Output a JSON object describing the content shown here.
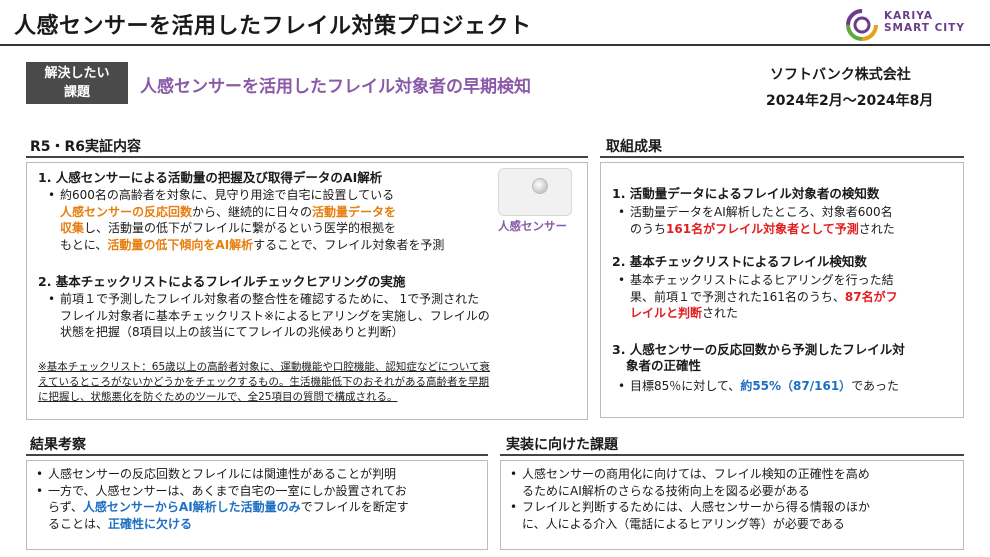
{
  "header": {
    "title": "人感センサーを活用したフレイル対策プロジェクト",
    "logo_line1": "KARIYA",
    "logo_line2": "SMART CITY"
  },
  "issue": {
    "badge_line1": "解決したい",
    "badge_line2": "課題",
    "text": "人感センサーを活用したフレイル対象者の早期検知",
    "company": "ソフトバンク株式会社",
    "period": "2024年2月～2024年8月"
  },
  "r5r6": {
    "heading": "R5・R6実証内容",
    "item1_title": "1. 人感センサーによる活動量の把握及び取得データのAI解析",
    "item1_l1": "約600名の高齢者を対象に、見守り用途で自宅に設置している",
    "item1_l2a": "人感センサーの反応回数",
    "item1_l2b": "から、継続的に日々の",
    "item1_l2c": "活動量データを",
    "item1_l3a": "収集",
    "item1_l3b": "し、活動量の低下がフレイルに繋がるという医学的根拠を",
    "item1_l4a": "もとに、",
    "item1_l4b": "活動量の低下傾向をAI解析",
    "item1_l4c": "することで、フレイル対象者を予測",
    "sensor_caption": "人感センサー",
    "item2_title": "2. 基本チェックリストによるフレイルチェックヒアリングの実施",
    "item2_l1": "前項１で予測したフレイル対象者の整合性を確認するために、 1で予測された",
    "item2_l2": "フレイル対象者に基本チェックリスト※によるヒアリングを実施し、フレイルの",
    "item2_l3": "状態を把握（8項目以上の該当にてフレイルの兆候ありと判断）",
    "note_l1": "※基本チェックリスト：65歳以上の高齢者対象に、運動機能や口腔機能、認知症などについて衰",
    "note_l2": "えているところがないかどうかをチェックするもの。生活機能低下のおそれがある高齢者を早期",
    "note_l3": "に把握し、状態悪化を防ぐためのツールで、全25項目の質問で構成される。"
  },
  "results": {
    "heading": "取組成果",
    "r1_title": "1. 活動量データによるフレイル対象者の検知数",
    "r1_l1": "活動量データをAI解析したところ、対象者600名",
    "r1_l2a": "のうち",
    "r1_l2b": "161名がフレイル対象者として予測",
    "r1_l2c": "された",
    "r2_title": "2. 基本チェックリストによるフレイル検知数",
    "r2_l1": "基本チェックリストによるヒアリングを行った結",
    "r2_l2a": "果、前項１で予測された161名のうち、",
    "r2_l2b": "87名がフ",
    "r2_l3a": "レイルと判断",
    "r2_l3b": "された",
    "r3_title_l1": "3. 人感センサーの反応回数から予測したフレイル対",
    "r3_title_l2": "象者の正確性",
    "r3_l1a": "目標85％に対して、",
    "r3_l1b": "約55%（87/161）",
    "r3_l1c": "であった"
  },
  "consideration": {
    "heading": "結果考察",
    "b1": "人感センサーの反応回数とフレイルには関連性があることが判明",
    "b2_l1": "一方で、人感センサーは、あくまで自宅の一室にしか設置されてお",
    "b2_l2a": "らず、",
    "b2_l2b": "人感センサーからAI解析した活動量のみ",
    "b2_l2c": "でフレイルを断定す",
    "b2_l3a": "ることは、",
    "b2_l3b": "正確性に欠ける"
  },
  "issues_impl": {
    "heading": "実装に向けた課題",
    "b1_l1": "人感センサーの商用化に向けては、フレイル検知の正確性を高め",
    "b1_l2": "るためにAI解析のさらなる技術向上を図る必要がある",
    "b2_l1": "フレイルと判断するためには、人感センサーから得る情報のほか",
    "b2_l2": "に、人による介入（電話によるヒアリング等）が必要である"
  },
  "colors": {
    "accent_purple": "#8a5aa8",
    "highlight_orange": "#e67e10",
    "highlight_red": "#e21f1f",
    "highlight_blue": "#1d6fc4"
  }
}
